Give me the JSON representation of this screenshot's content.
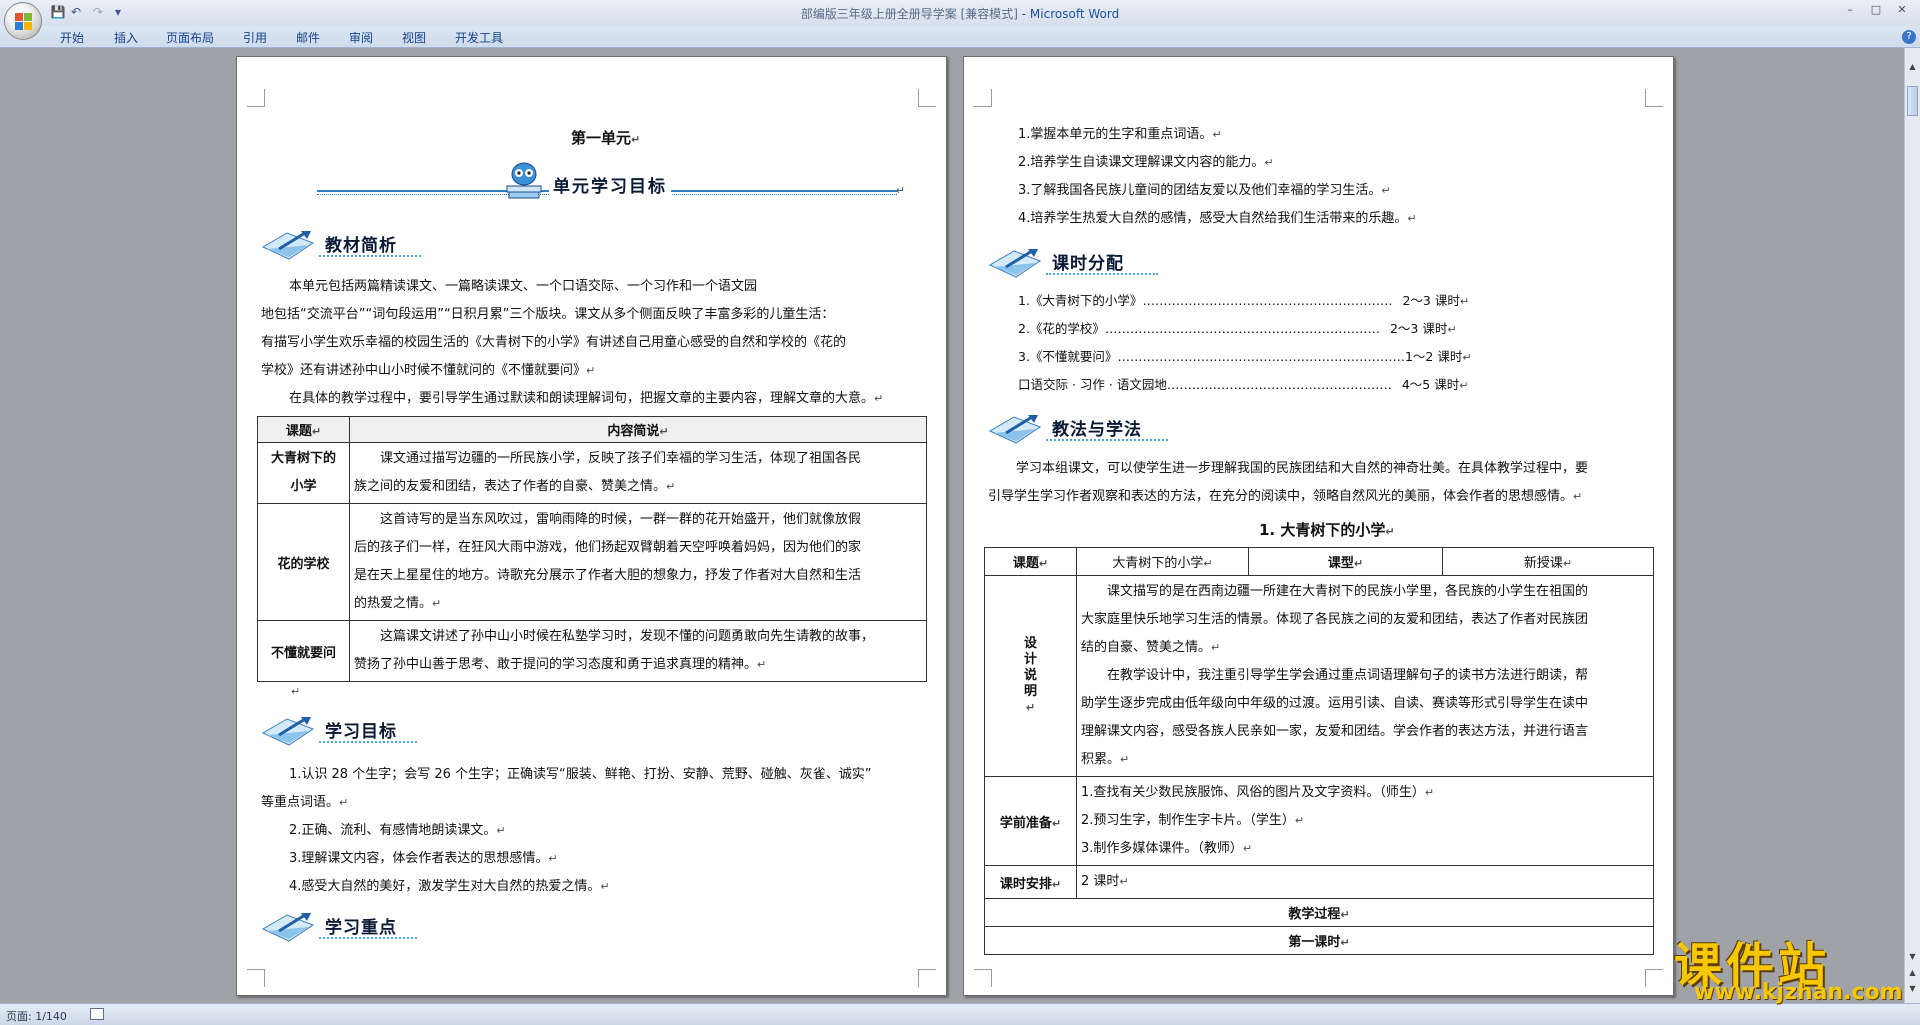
{
  "window": {
    "title": "部编版三年级上册全册导学案 [兼容模式]",
    "title_app": " - Microsoft Word",
    "controls": {
      "minimize": "–",
      "maximize": "□",
      "close": "✕"
    }
  },
  "quick_access": {
    "save": "💾",
    "undo": "↶",
    "redo": "↷",
    "customize": "▾"
  },
  "ribbon": {
    "tabs": [
      "开始",
      "插入",
      "页面布局",
      "引用",
      "邮件",
      "审阅",
      "视图",
      "开发工具"
    ],
    "help": "?"
  },
  "page1": {
    "unit_title": "第一单元",
    "unit_banner": "单元学习目标",
    "sec1_title": "教材简析",
    "intro": [
      "本单元包括两篇精读课文、一篇略读课文、一个口语交际、一个习作和一个语文园",
      "地包括“交流平台”“词句段运用”“日积月累”三个版块。课文从多个侧面反映了丰富多彩的儿童生活：",
      "有描写小学生欢乐幸福的校园生活的《大青树下的小学》有讲述自己用童心感受的自然和学校的《花的",
      "学校》还有讲述孙中山小时候不懂就问的《不懂就要问》",
      "在具体的教学过程中，要引导学生通过默读和朗读理解词句，把握文章的主要内容，理解文章的大意。"
    ],
    "table": {
      "headers": [
        "课题",
        "内容简说"
      ],
      "rows": [
        {
          "title": "大青树下的小学",
          "lines": [
            "课文通过描写边疆的一所民族小学，反映了孩子们幸福的学习生活，体现了祖国各民",
            "族之间的友爱和团结，表达了作者的自豪、赞美之情。"
          ]
        },
        {
          "title": "花的学校",
          "lines": [
            "这首诗写的是当东风吹过，雷响雨降的时候，一群一群的花开始盛开，他们就像放假",
            "后的孩子们一样，在狂风大雨中游戏，他们扬起双臂朝着天空呼唤着妈妈，因为他们的家",
            "是在天上星星住的地方。诗歌充分展示了作者大胆的想象力，抒发了作者对大自然和生活",
            "的热爱之情。"
          ]
        },
        {
          "title": "不懂就要问",
          "lines": [
            "这篇课文讲述了孙中山小时候在私塾学习时，发现不懂的问题勇敢向先生请教的故事，",
            "赞扬了孙中山善于思考、敢于提问的学习态度和勇于追求真理的精神。"
          ]
        }
      ]
    },
    "sec2_title": "学习目标",
    "goals": [
      "1.认识 28 个生字；会写 26 个生字；正确读写“服装、鲜艳、打扮、安静、荒野、碰触、灰雀、诚实”",
      "等重点词语。",
      "2.正确、流利、有感情地朗读课文。",
      "3.理解课文内容，体会作者表达的思想感情。",
      "4.感受大自然的美好，激发学生对大自然的热爱之情。"
    ],
    "sec3_title": "学习重点"
  },
  "page2": {
    "goals": [
      "1.掌握本单元的生字和重点词语。",
      "2.培养学生自读课文理解课文内容的能力。",
      "3.了解我国各民族儿童间的团结友爱以及他们幸福的学习生活。",
      "4.培养学生热爱大自然的感情，感受大自然给我们生活带来的乐趣。"
    ],
    "sec_hours": "课时分配",
    "hours": [
      {
        "item": "1.《大青树下的小学》",
        "dots": "……………………………………………………",
        "val": "2～3 课时"
      },
      {
        "item": "2.《花的学校》",
        "dots": "…………………………………………………………",
        "val": "2～3 课时"
      },
      {
        "item": "3.《不懂就要问》",
        "dots": "……………………………………………………………",
        "val": "1～2 课时"
      },
      {
        "item": "口语交际 · 习作 · 语文园地",
        "dots": "………………………………………………",
        "val": "4～5 课时"
      }
    ],
    "sec_method": "教法与学法",
    "method": [
      "学习本组课文，可以使学生进一步理解我国的民族团结和大自然的神奇壮美。在具体教学过程中，要",
      "引导学生学习作者观察和表达的方法，在充分的阅读中，领略自然风光的美丽，体会作者的思想感情。"
    ],
    "lesson_title": "1. 大青树下的小学",
    "lesson_table": {
      "topic_label": "课题",
      "topic": "大青树下的小学",
      "type_label": "课型",
      "type": "新授课",
      "design_label": "设计说明",
      "design": [
        "课文描写的是在西南边疆一所建在大青树下的民族小学里，各民族的小学生在祖国的",
        "大家庭里快乐地学习生活的情景。体现了各民族之间的友爱和团结，表达了作者对民族团",
        "结的自豪、赞美之情。",
        "在教学设计中，我注重引导学生学会通过重点词语理解句子的读书方法进行朗读，帮",
        "助学生逐步完成由低年级向中年级的过渡。运用引读、自读、赛读等形式引导学生在读中",
        "理解课文内容，感受各族人民亲如一家，友爱和团结。学会作者的表达方法，并进行语言",
        "积累。"
      ],
      "prep_label": "学前准备",
      "prep": [
        "1.查找有关少数民族服饰、风俗的图片及文字资料。（师生）",
        "2.预习生字，制作生字卡片。（学生）",
        "3.制作多媒体课件。（教师）"
      ],
      "hours_label": "课时安排",
      "hours": "2 课时",
      "process": "教学过程",
      "first": "第一课时"
    }
  },
  "status": {
    "page": "页面: 1/140"
  },
  "watermark": {
    "big": "课件站",
    "small": "www.kjzhan.com"
  }
}
